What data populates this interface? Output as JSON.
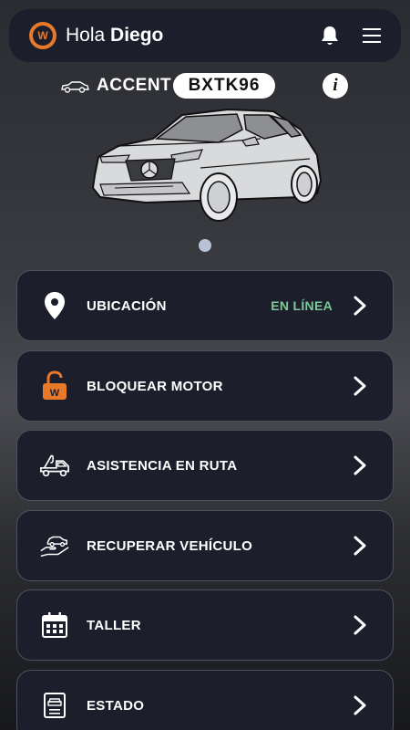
{
  "header": {
    "greeting_prefix": "Hola",
    "user_name": "Diego",
    "logo_letter": "W",
    "icons": [
      "bell-icon",
      "menu-icon"
    ]
  },
  "vehicle": {
    "model": "ACCENT",
    "plate": "BXTK96",
    "info_glyph": "i",
    "carousel_pages": 1
  },
  "menu": {
    "items": [
      {
        "label": "UBICACIÓN",
        "status": "EN LÍNEA",
        "icon": "location-pin-icon"
      },
      {
        "label": "BLOQUEAR MOTOR",
        "status": "",
        "icon": "unlock-icon"
      },
      {
        "label": "ASISTENCIA EN RUTA",
        "status": "",
        "icon": "tow-truck-icon"
      },
      {
        "label": "RECUPERAR VEHÍCULO",
        "status": "",
        "icon": "hand-car-icon"
      },
      {
        "label": "TALLER",
        "status": "",
        "icon": "calendar-icon"
      },
      {
        "label": "ESTADO",
        "status": "",
        "icon": "document-icon"
      }
    ]
  },
  "colors": {
    "card_bg": "#1c1f2b",
    "accent_orange": "#e8792b",
    "status_green": "#7fc89a"
  }
}
